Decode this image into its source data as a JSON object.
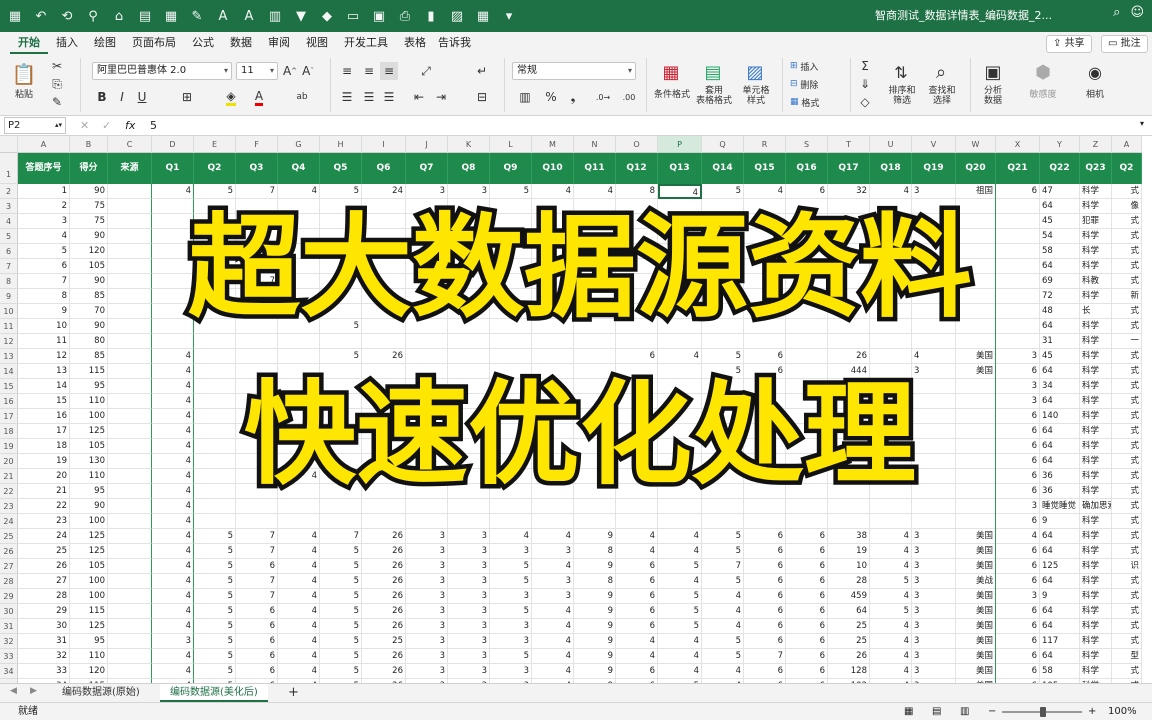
{
  "window": {
    "title": "智商测试_数据详情表_编码数据_2..."
  },
  "tabs": [
    {
      "label": "开始",
      "active": true
    },
    {
      "label": "插入"
    },
    {
      "label": "绘图"
    },
    {
      "label": "页面布局"
    },
    {
      "label": "公式"
    },
    {
      "label": "数据"
    },
    {
      "label": "审阅"
    },
    {
      "label": "视图"
    },
    {
      "label": "开发工具"
    },
    {
      "label": "表格"
    },
    {
      "label": "告诉我"
    }
  ],
  "share": {
    "share_label": "共享",
    "comment_label": "批注"
  },
  "ribbon": {
    "paste_label": "粘贴",
    "font_name": "阿里巴巴普惠体 2.0",
    "font_size": "11",
    "bold": "B",
    "italic": "I",
    "underline": "U",
    "number_format": "常规",
    "conditional_format": "条件格式",
    "table_format": "套用\n表格格式",
    "cell_style": "单元格\n样式",
    "insert": "插入",
    "delete": "删除",
    "format": "格式",
    "sort_filter": "排序和\n筛选",
    "find_select": "查找和\n选择",
    "analyze": "分析\n数据",
    "sensitivity": "敏感度",
    "camera": "相机"
  },
  "formula_bar": {
    "cell_ref": "P2",
    "fx": "fx",
    "value": "5"
  },
  "columns": [
    "A",
    "B",
    "C",
    "D",
    "E",
    "F",
    "G",
    "H",
    "I",
    "J",
    "K",
    "L",
    "M",
    "N",
    "O",
    "P",
    "Q",
    "R",
    "S",
    "T",
    "U",
    "V",
    "W",
    "X",
    "Y",
    "Z",
    "A"
  ],
  "header_row": [
    "答题序号",
    "得分",
    "来源",
    "Q1",
    "Q2",
    "Q3",
    "Q4",
    "Q5",
    "Q6",
    "Q7",
    "Q8",
    "Q9",
    "Q10",
    "Q11",
    "Q12",
    "Q13",
    "Q14",
    "Q15",
    "Q16",
    "Q17",
    "Q18",
    "Q19",
    "Q20",
    "Q21",
    "Q22",
    "Q23",
    "Q2"
  ],
  "rows": [
    {
      "r": "2",
      "c": [
        "1",
        "90",
        "",
        "4",
        "5",
        "7",
        "4",
        "5",
        "24",
        "3",
        "3",
        "5",
        "4",
        "4",
        "8",
        "4",
        "5",
        "4",
        "6",
        "32",
        "4",
        "3",
        "祖国",
        "6",
        "47",
        "科学",
        "式"
      ]
    },
    {
      "r": "3",
      "c": [
        "2",
        "75",
        "",
        "",
        "",
        "",
        "",
        "",
        "",
        "",
        "",
        "",
        "",
        "",
        "",
        "",
        "",
        "",
        "",
        "",
        "",
        "",
        "",
        "",
        "64",
        "科学",
        "像"
      ]
    },
    {
      "r": "4",
      "c": [
        "3",
        "75",
        "",
        "",
        "",
        "",
        "",
        "",
        "",
        "",
        "",
        "",
        "",
        "",
        "",
        "",
        "",
        "",
        "",
        "",
        "",
        "",
        "",
        "",
        "45",
        "犯罪",
        "式"
      ]
    },
    {
      "r": "5",
      "c": [
        "4",
        "90",
        "",
        "",
        "",
        "",
        "",
        "",
        "",
        "",
        "",
        "",
        "",
        "",
        "",
        "",
        "",
        "",
        "",
        "",
        "",
        "",
        "",
        "",
        "54",
        "科学",
        "式"
      ]
    },
    {
      "r": "6",
      "c": [
        "5",
        "120",
        "",
        "",
        "",
        "",
        "",
        "",
        "",
        "",
        "",
        "",
        "",
        "",
        "",
        "",
        "",
        "",
        "",
        "",
        "",
        "",
        "",
        "",
        "58",
        "科学",
        "式"
      ]
    },
    {
      "r": "7",
      "c": [
        "6",
        "105",
        "",
        "",
        "",
        "",
        "",
        "",
        "",
        "",
        "",
        "",
        "",
        "",
        "",
        "",
        "",
        "",
        "",
        "",
        "",
        "",
        "",
        "",
        "64",
        "科学",
        "式"
      ]
    },
    {
      "r": "8",
      "c": [
        "7",
        "90",
        "",
        "",
        "",
        "7",
        "",
        "",
        "",
        "",
        "",
        "",
        "",
        "",
        "",
        "",
        "",
        "",
        "",
        "",
        "",
        "",
        "",
        "",
        "69",
        "科教",
        "式"
      ]
    },
    {
      "r": "9",
      "c": [
        "8",
        "85",
        "",
        "",
        "",
        "",
        "",
        "",
        "",
        "",
        "",
        "",
        "",
        "",
        "",
        "",
        "",
        "",
        "",
        "",
        "",
        "",
        "",
        "",
        "72",
        "科学",
        "新"
      ]
    },
    {
      "r": "10",
      "c": [
        "9",
        "70",
        "",
        "",
        "",
        "",
        "",
        "",
        "",
        "",
        "",
        "",
        "",
        "",
        "",
        "",
        "",
        "",
        "",
        "",
        "",
        "",
        "",
        "",
        "48",
        "长",
        "式"
      ]
    },
    {
      "r": "11",
      "c": [
        "10",
        "90",
        "",
        "",
        "",
        "",
        "",
        "5",
        "",
        "",
        "",
        "",
        "",
        "",
        "",
        "",
        "",
        "",
        "",
        "",
        "",
        "",
        "",
        "",
        "64",
        "科学",
        "式"
      ]
    },
    {
      "r": "12",
      "c": [
        "11",
        "80",
        "",
        "",
        "",
        "",
        "",
        "",
        "",
        "",
        "",
        "",
        "",
        "",
        "",
        "",
        "",
        "",
        "",
        "",
        "",
        "",
        "",
        "",
        "31",
        "科学",
        "一"
      ]
    },
    {
      "r": "13",
      "c": [
        "12",
        "85",
        "",
        "4",
        "",
        "",
        "",
        "5",
        "26",
        "",
        "",
        "",
        "",
        "",
        "6",
        "4",
        "5",
        "6",
        "",
        "26",
        "",
        "4",
        "美国",
        "3",
        "45",
        "科学",
        "式"
      ]
    },
    {
      "r": "14",
      "c": [
        "13",
        "115",
        "",
        "4",
        "",
        "",
        "",
        "",
        "",
        "",
        "",
        "",
        "",
        "",
        "",
        "",
        "5",
        "6",
        "",
        "444",
        "",
        "3",
        "美国",
        "6",
        "64",
        "科学",
        "式"
      ]
    },
    {
      "r": "15",
      "c": [
        "14",
        "95",
        "",
        "4",
        "",
        "",
        "",
        "",
        "",
        "",
        "",
        "",
        "",
        "",
        "",
        "",
        "",
        "",
        "",
        "",
        "",
        "",
        "",
        "3",
        "34",
        "科学",
        "式"
      ]
    },
    {
      "r": "16",
      "c": [
        "15",
        "110",
        "",
        "4",
        "",
        "",
        "",
        "",
        "",
        "",
        "",
        "",
        "",
        "",
        "",
        "",
        "",
        "",
        "",
        "",
        "",
        "",
        "",
        "3",
        "64",
        "科学",
        "式"
      ]
    },
    {
      "r": "17",
      "c": [
        "16",
        "100",
        "",
        "4",
        "",
        "",
        "",
        "",
        "",
        "",
        "",
        "",
        "",
        "",
        "",
        "",
        "",
        "",
        "",
        "",
        "",
        "",
        "",
        "6",
        "140",
        "科学",
        "式"
      ]
    },
    {
      "r": "18",
      "c": [
        "17",
        "125",
        "",
        "4",
        "",
        "",
        "",
        "",
        "",
        "",
        "",
        "",
        "",
        "",
        "",
        "",
        "",
        "",
        "",
        "",
        "",
        "",
        "",
        "6",
        "64",
        "科学",
        "式"
      ]
    },
    {
      "r": "19",
      "c": [
        "18",
        "105",
        "",
        "4",
        "",
        "",
        "",
        "",
        "",
        "",
        "",
        "",
        "",
        "",
        "",
        "",
        "",
        "",
        "",
        "",
        "",
        "",
        "",
        "6",
        "64",
        "科学",
        "式"
      ]
    },
    {
      "r": "20",
      "c": [
        "19",
        "130",
        "",
        "4",
        "",
        "",
        "",
        "",
        "",
        "",
        "",
        "",
        "",
        "",
        "",
        "",
        "",
        "",
        "",
        "",
        "",
        "",
        "",
        "6",
        "64",
        "科学",
        "式"
      ]
    },
    {
      "r": "21",
      "c": [
        "20",
        "110",
        "",
        "4",
        "",
        "",
        "4",
        "",
        "",
        "",
        "",
        "",
        "",
        "",
        "",
        "",
        "",
        "",
        "",
        "",
        "",
        "",
        "",
        "6",
        "36",
        "科学",
        "式"
      ]
    },
    {
      "r": "22",
      "c": [
        "21",
        "95",
        "",
        "4",
        "",
        "",
        "",
        "",
        "",
        "",
        "",
        "",
        "",
        "",
        "",
        "",
        "",
        "",
        "",
        "",
        "",
        "",
        "",
        "6",
        "36",
        "科学",
        "式"
      ]
    },
    {
      "r": "23",
      "c": [
        "22",
        "90",
        "",
        "4",
        "",
        "",
        "",
        "",
        "",
        "",
        "",
        "",
        "",
        "",
        "",
        "",
        "",
        "",
        "",
        "",
        "",
        "",
        "",
        "3",
        "睡觉睡觉",
        "确加思索",
        "式"
      ]
    },
    {
      "r": "24",
      "c": [
        "23",
        "100",
        "",
        "4",
        "",
        "",
        "",
        "",
        "",
        "",
        "",
        "",
        "",
        "",
        "",
        "",
        "",
        "",
        "",
        "",
        "",
        "",
        "",
        "6",
        "9",
        "科学",
        "式"
      ]
    },
    {
      "r": "25",
      "c": [
        "24",
        "125",
        "",
        "4",
        "5",
        "7",
        "4",
        "7",
        "26",
        "3",
        "3",
        "4",
        "4",
        "9",
        "4",
        "4",
        "5",
        "6",
        "6",
        "38",
        "4",
        "3",
        "美国",
        "4",
        "64",
        "科学",
        "式"
      ]
    },
    {
      "r": "26",
      "c": [
        "25",
        "125",
        "",
        "4",
        "5",
        "7",
        "4",
        "5",
        "26",
        "3",
        "3",
        "3",
        "3",
        "8",
        "4",
        "4",
        "5",
        "6",
        "6",
        "19",
        "4",
        "3",
        "美国",
        "6",
        "64",
        "科学",
        "式"
      ]
    },
    {
      "r": "27",
      "c": [
        "26",
        "105",
        "",
        "4",
        "5",
        "6",
        "4",
        "5",
        "26",
        "3",
        "3",
        "5",
        "4",
        "9",
        "6",
        "5",
        "7",
        "6",
        "6",
        "10",
        "4",
        "3",
        "美国",
        "6",
        "125",
        "科学",
        "识"
      ]
    },
    {
      "r": "28",
      "c": [
        "27",
        "100",
        "",
        "4",
        "5",
        "7",
        "4",
        "5",
        "26",
        "3",
        "3",
        "5",
        "3",
        "8",
        "6",
        "4",
        "5",
        "6",
        "6",
        "28",
        "5",
        "3",
        "美战",
        "6",
        "64",
        "科学",
        "式"
      ]
    },
    {
      "r": "29",
      "c": [
        "28",
        "100",
        "",
        "4",
        "5",
        "7",
        "4",
        "5",
        "26",
        "3",
        "3",
        "3",
        "3",
        "9",
        "6",
        "5",
        "4",
        "6",
        "6",
        "459",
        "4",
        "3",
        "美国",
        "3",
        "9",
        "科学",
        "式"
      ]
    },
    {
      "r": "30",
      "c": [
        "29",
        "115",
        "",
        "4",
        "5",
        "6",
        "4",
        "5",
        "26",
        "3",
        "3",
        "5",
        "4",
        "9",
        "6",
        "5",
        "4",
        "6",
        "6",
        "64",
        "5",
        "3",
        "美国",
        "6",
        "64",
        "科学",
        "式"
      ]
    },
    {
      "r": "31",
      "c": [
        "30",
        "125",
        "",
        "4",
        "5",
        "6",
        "4",
        "5",
        "26",
        "3",
        "3",
        "3",
        "4",
        "9",
        "6",
        "5",
        "4",
        "6",
        "6",
        "25",
        "4",
        "3",
        "美国",
        "6",
        "64",
        "科学",
        "式"
      ]
    },
    {
      "r": "32",
      "c": [
        "31",
        "95",
        "",
        "3",
        "5",
        "6",
        "4",
        "5",
        "25",
        "3",
        "3",
        "3",
        "4",
        "9",
        "4",
        "4",
        "5",
        "6",
        "6",
        "25",
        "4",
        "3",
        "美国",
        "6",
        "117",
        "科学",
        "式"
      ]
    },
    {
      "r": "33",
      "c": [
        "32",
        "110",
        "",
        "4",
        "5",
        "6",
        "4",
        "5",
        "26",
        "3",
        "3",
        "5",
        "4",
        "9",
        "4",
        "4",
        "5",
        "7",
        "6",
        "26",
        "4",
        "3",
        "美国",
        "6",
        "64",
        "科学",
        "型"
      ]
    },
    {
      "r": "34",
      "c": [
        "33",
        "120",
        "",
        "4",
        "5",
        "6",
        "4",
        "5",
        "26",
        "3",
        "3",
        "3",
        "4",
        "9",
        "6",
        "4",
        "4",
        "6",
        "6",
        "128",
        "4",
        "3",
        "美国",
        "6",
        "58",
        "科学",
        "式"
      ]
    },
    {
      "r": "35",
      "c": [
        "34",
        "115",
        "",
        "4",
        "5",
        "6",
        "4",
        "5",
        "26",
        "3",
        "3",
        "3",
        "4",
        "9",
        "6",
        "5",
        "4",
        "6",
        "6",
        "102",
        "4",
        "3",
        "美国",
        "6",
        "105",
        "科学",
        "式"
      ]
    }
  ],
  "overlay": {
    "line1": "超大数据源资料",
    "line2": "快速优化处理"
  },
  "sheets": [
    {
      "label": "编码数据源(原始)"
    },
    {
      "label": "编码数据源(美化后)",
      "active": true
    }
  ],
  "add_sheet": "+",
  "status": {
    "left": "就绪",
    "zoom": "100%"
  },
  "colors": {
    "accent": "#1e7145",
    "header_fill": "#1e8a4c",
    "overlay_text": "#ffe600"
  }
}
